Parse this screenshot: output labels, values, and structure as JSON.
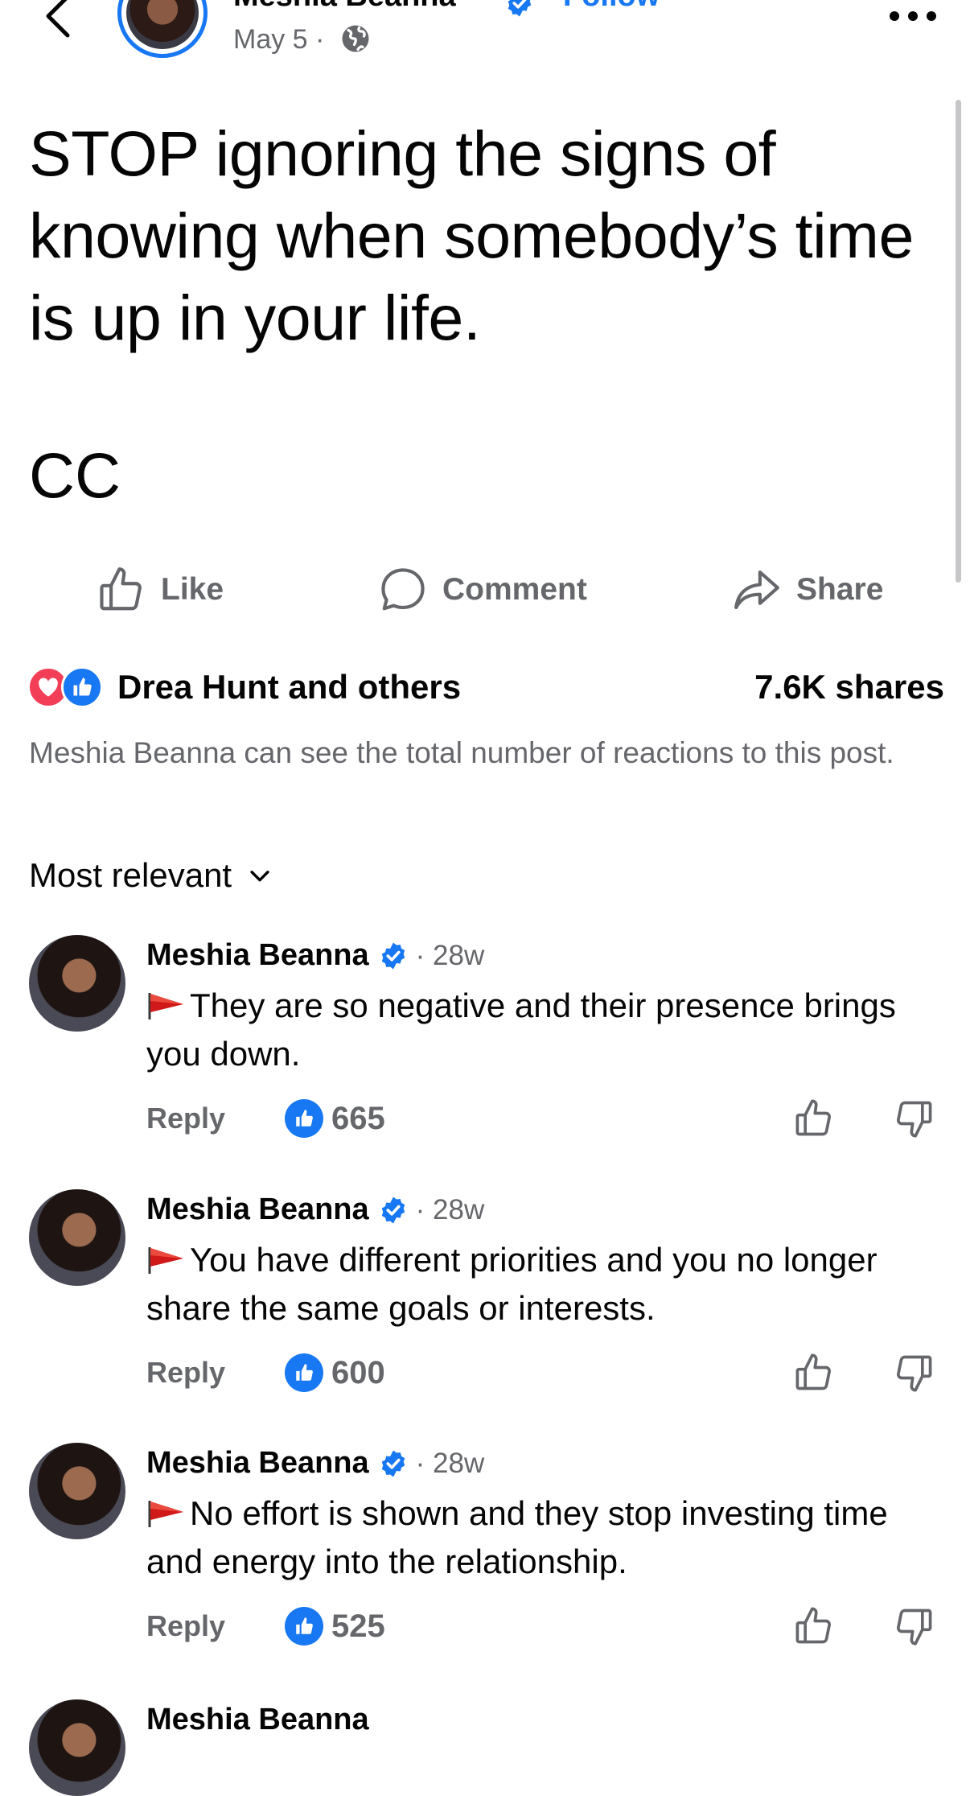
{
  "header": {
    "author": "Meshia Beanna",
    "follow_label": "Follow",
    "date": "May 5 ·",
    "icons": [
      "back-arrow-icon",
      "verified-badge-icon",
      "globe-icon",
      "more-dots-icon"
    ]
  },
  "post": {
    "text": "STOP ignoring the signs of knowing when somebody’s time is up in your life.",
    "cc": "CC"
  },
  "actions": {
    "like_label": "Like",
    "comment_label": "Comment",
    "share_label": "Share"
  },
  "reactions": {
    "names": "Drea Hunt and others",
    "shares": "7.6K shares",
    "note": "Meshia Beanna can see the total number of reactions to this post.",
    "colors": {
      "love": "#f33e58",
      "like": "#1877f2"
    }
  },
  "comments_section": {
    "sort_label": "Most relevant",
    "comments": [
      {
        "author": "Meshia Beanna",
        "time": "· 28w",
        "text": "They are so negative and their presence brings you down.",
        "reply_label": "Reply",
        "likes": "665"
      },
      {
        "author": "Meshia Beanna",
        "time": "· 28w",
        "text": "You have different priorities and you no longer share the same goals or interests.",
        "reply_label": "Reply",
        "likes": "600"
      },
      {
        "author": "Meshia Beanna",
        "time": "· 28w",
        "text": "No effort is shown and they stop investing time and energy into the relationship.",
        "reply_label": "Reply",
        "likes": "525"
      }
    ],
    "peek_author": "Meshia Beanna"
  },
  "colors": {
    "accent": "#1877f2",
    "secondary_text": "#65676b",
    "flag": "#d01a1a"
  }
}
